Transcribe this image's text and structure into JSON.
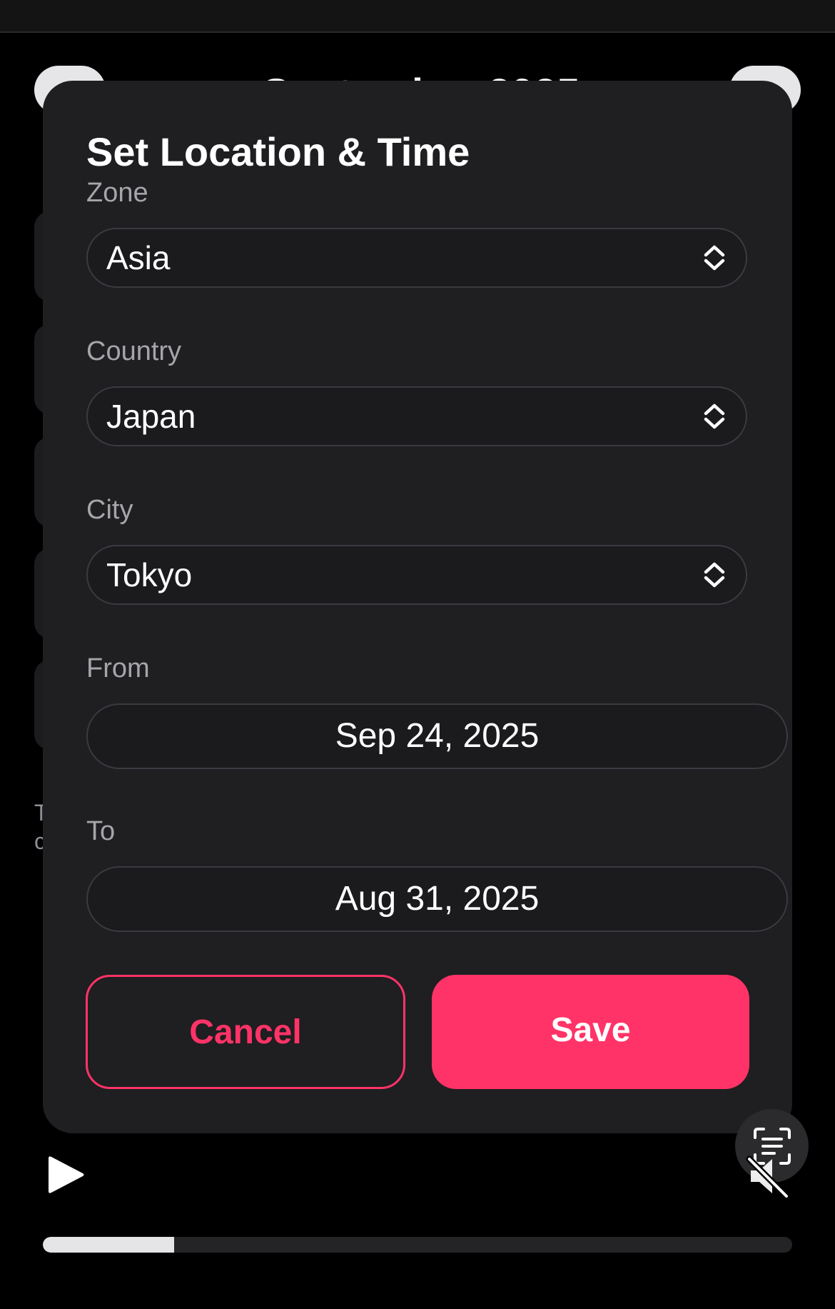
{
  "background": {
    "month_heading": "September 2025",
    "note_text": "T c"
  },
  "dialog": {
    "title": "Set Location & Time",
    "fields": {
      "zone": {
        "label": "Zone",
        "value": "Asia",
        "icon": "chevron-up-down-icon"
      },
      "country": {
        "label": "Country",
        "value": "Japan",
        "icon": "chevron-up-down-icon"
      },
      "city": {
        "label": "City",
        "value": "Tokyo",
        "icon": "chevron-up-down-icon"
      },
      "from": {
        "label": "From",
        "value": "Sep 24, 2025"
      },
      "to": {
        "label": "To",
        "value": "Aug 31, 2025"
      }
    },
    "buttons": {
      "cancel_label": "Cancel",
      "save_label": "Save"
    }
  },
  "player": {
    "play_icon": "play-icon",
    "ocr_icon": "live-text-icon",
    "mute_icon": "speaker-muted-icon",
    "progress_fraction": 0.175
  },
  "colors": {
    "accent": "#ff3367",
    "dialog_background": "#1f1e21",
    "page_background": "#000000"
  }
}
